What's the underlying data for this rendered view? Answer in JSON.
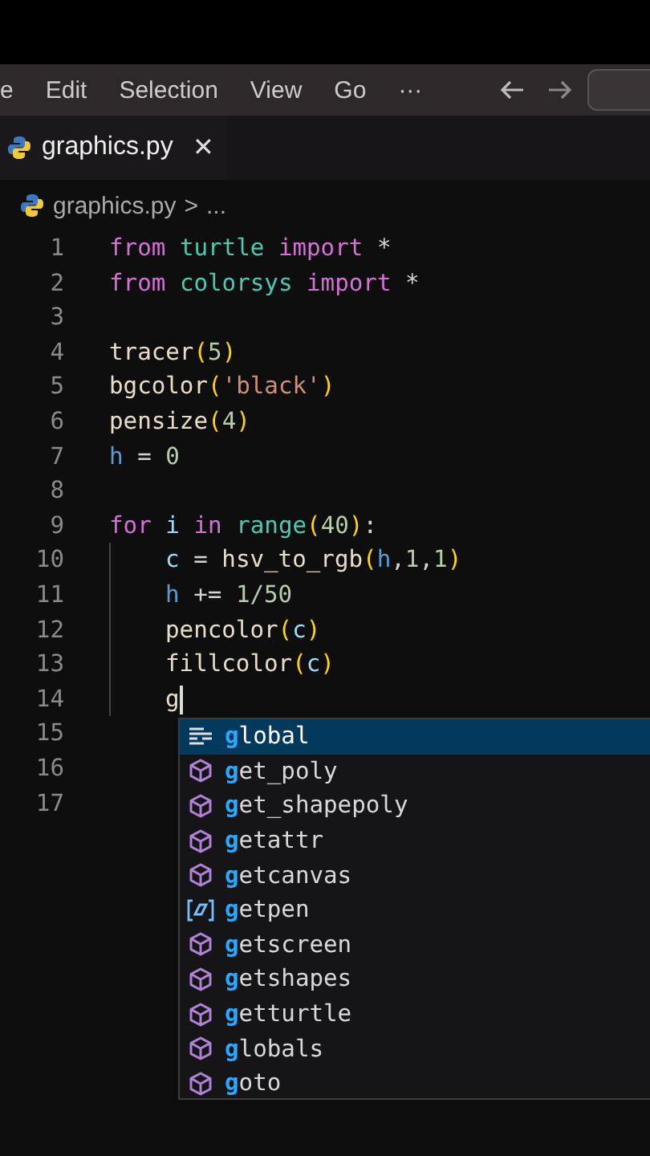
{
  "menubar": {
    "items": [
      "e",
      "Edit",
      "Selection",
      "View",
      "Go",
      "···"
    ]
  },
  "tab": {
    "title": "graphics.py",
    "close": "✕",
    "selected": true
  },
  "breadcrumb": {
    "file": "graphics.py",
    "separator": ">",
    "rest": "..."
  },
  "lines": [
    {
      "number": "1",
      "indent": false,
      "cursor": false,
      "tokens": [
        {
          "kind": "keyword",
          "text": "from "
        },
        {
          "kind": "module",
          "text": "turtle "
        },
        {
          "kind": "keyword",
          "text": "import "
        },
        {
          "kind": "plain",
          "text": "*"
        }
      ]
    },
    {
      "number": "2",
      "indent": false,
      "cursor": false,
      "tokens": [
        {
          "kind": "keyword",
          "text": "from "
        },
        {
          "kind": "module",
          "text": "colorsys "
        },
        {
          "kind": "keyword",
          "text": "import "
        },
        {
          "kind": "plain",
          "text": "*"
        }
      ]
    },
    {
      "number": "3",
      "indent": false,
      "cursor": false
    },
    {
      "number": "4",
      "indent": false,
      "cursor": false,
      "tokens": [
        {
          "kind": "function",
          "text": "tracer"
        },
        {
          "kind": "paren",
          "text": "("
        },
        {
          "kind": "number",
          "text": "5"
        },
        {
          "kind": "paren",
          "text": ")"
        }
      ]
    },
    {
      "number": "5",
      "indent": false,
      "cursor": false,
      "tokens": [
        {
          "kind": "function",
          "text": "bgcolor"
        },
        {
          "kind": "paren",
          "text": "("
        },
        {
          "kind": "string",
          "text": "'black'"
        },
        {
          "kind": "paren",
          "text": ")"
        }
      ]
    },
    {
      "number": "6",
      "indent": false,
      "cursor": false,
      "tokens": [
        {
          "kind": "function",
          "text": "pensize"
        },
        {
          "kind": "paren",
          "text": "("
        },
        {
          "kind": "number",
          "text": "4"
        },
        {
          "kind": "paren",
          "text": ")"
        }
      ]
    },
    {
      "number": "7",
      "indent": false,
      "cursor": false,
      "tokens": [
        {
          "kind": "variable",
          "text": "h"
        },
        {
          "kind": "plain",
          "text": " = "
        },
        {
          "kind": "number",
          "text": "0"
        }
      ]
    },
    {
      "number": "8",
      "indent": false,
      "cursor": false
    },
    {
      "number": "9",
      "indent": false,
      "cursor": false,
      "tokens": [
        {
          "kind": "keyword",
          "text": "for "
        },
        {
          "kind": "param",
          "text": "i "
        },
        {
          "kind": "keyword",
          "text": "in "
        },
        {
          "kind": "module",
          "text": "range"
        },
        {
          "kind": "paren",
          "text": "("
        },
        {
          "kind": "number",
          "text": "40"
        },
        {
          "kind": "paren",
          "text": ")"
        },
        {
          "kind": "plain",
          "text": ":"
        }
      ]
    },
    {
      "number": "10",
      "indent": true,
      "cursor": false,
      "tokens": [
        {
          "kind": "param",
          "text": "c"
        },
        {
          "kind": "plain",
          "text": " = "
        },
        {
          "kind": "function",
          "text": "hsv_to_rgb"
        },
        {
          "kind": "paren",
          "text": "("
        },
        {
          "kind": "variable",
          "text": "h"
        },
        {
          "kind": "plain",
          "text": ","
        },
        {
          "kind": "number",
          "text": "1"
        },
        {
          "kind": "plain",
          "text": ","
        },
        {
          "kind": "number",
          "text": "1"
        },
        {
          "kind": "paren",
          "text": ")"
        }
      ]
    },
    {
      "number": "11",
      "indent": true,
      "cursor": false,
      "tokens": [
        {
          "kind": "variable",
          "text": "h"
        },
        {
          "kind": "plain",
          "text": " += "
        },
        {
          "kind": "number",
          "text": "1/50"
        }
      ]
    },
    {
      "number": "12",
      "indent": true,
      "cursor": false,
      "tokens": [
        {
          "kind": "function",
          "text": "pencolor"
        },
        {
          "kind": "paren",
          "text": "("
        },
        {
          "kind": "param",
          "text": "c"
        },
        {
          "kind": "paren",
          "text": ")"
        }
      ]
    },
    {
      "number": "13",
      "indent": true,
      "cursor": false,
      "tokens": [
        {
          "kind": "function",
          "text": "fillcolor"
        },
        {
          "kind": "paren",
          "text": "("
        },
        {
          "kind": "param",
          "text": "c"
        },
        {
          "kind": "paren",
          "text": ")"
        }
      ]
    },
    {
      "number": "14",
      "indent": true,
      "cursor": true,
      "tokens": [
        {
          "kind": "function",
          "text": "g"
        }
      ]
    },
    {
      "number": "15",
      "indent": false,
      "cursor": false
    },
    {
      "number": "16",
      "indent": false,
      "cursor": false
    },
    {
      "number": "17",
      "indent": false,
      "cursor": false
    }
  ],
  "suggest": {
    "items": [
      {
        "label": "global",
        "kind": "keyword",
        "selected": true
      },
      {
        "label": "get_poly",
        "kind": "method",
        "selected": false
      },
      {
        "label": "get_shapepoly",
        "kind": "method",
        "selected": false
      },
      {
        "label": "getattr",
        "kind": "method",
        "selected": false
      },
      {
        "label": "getcanvas",
        "kind": "method",
        "selected": false
      },
      {
        "label": "getpen",
        "kind": "variable",
        "selected": false
      },
      {
        "label": "getscreen",
        "kind": "method",
        "selected": false
      },
      {
        "label": "getshapes",
        "kind": "method",
        "selected": false
      },
      {
        "label": "getturtle",
        "kind": "method",
        "selected": false
      },
      {
        "label": "globals",
        "kind": "method",
        "selected": false
      },
      {
        "label": "goto",
        "kind": "method",
        "selected": false
      }
    ]
  }
}
